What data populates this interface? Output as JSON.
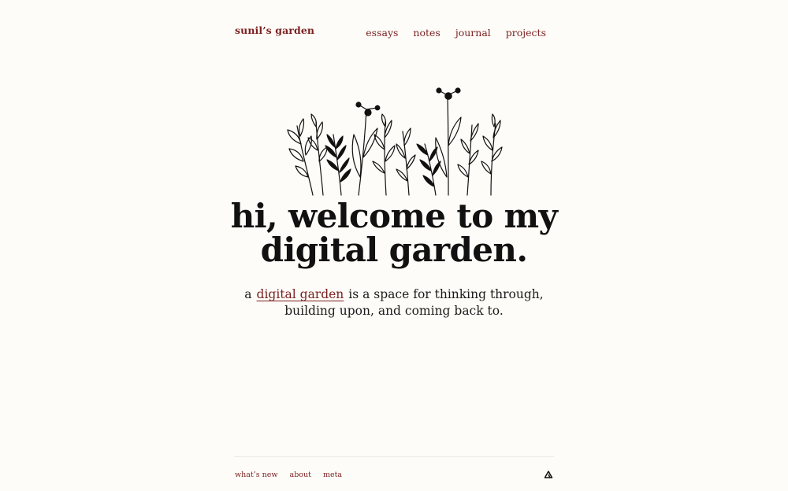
{
  "site": {
    "title": "sunil’s garden"
  },
  "nav": {
    "items": [
      {
        "label": "essays"
      },
      {
        "label": "notes"
      },
      {
        "label": "journal"
      },
      {
        "label": "projects"
      }
    ]
  },
  "hero": {
    "headline_line1": "hi, welcome to my",
    "headline_line2": "digital garden.",
    "tagline_prefix": "a",
    "tagline_link": "digital garden",
    "tagline_rest": "is a space for thinking through,",
    "tagline_line2": "building upon, and coming back to.",
    "illustration_icon": "wildflowers-illustration"
  },
  "footer": {
    "links": [
      {
        "label": "what’s new"
      },
      {
        "label": "about"
      },
      {
        "label": "meta"
      }
    ],
    "logo_icon": "triangle-logo-icon"
  },
  "colors": {
    "background": "#fdfcf8",
    "accent": "#7a1f1f",
    "text": "#111111",
    "rule": "#ebe9e4"
  }
}
